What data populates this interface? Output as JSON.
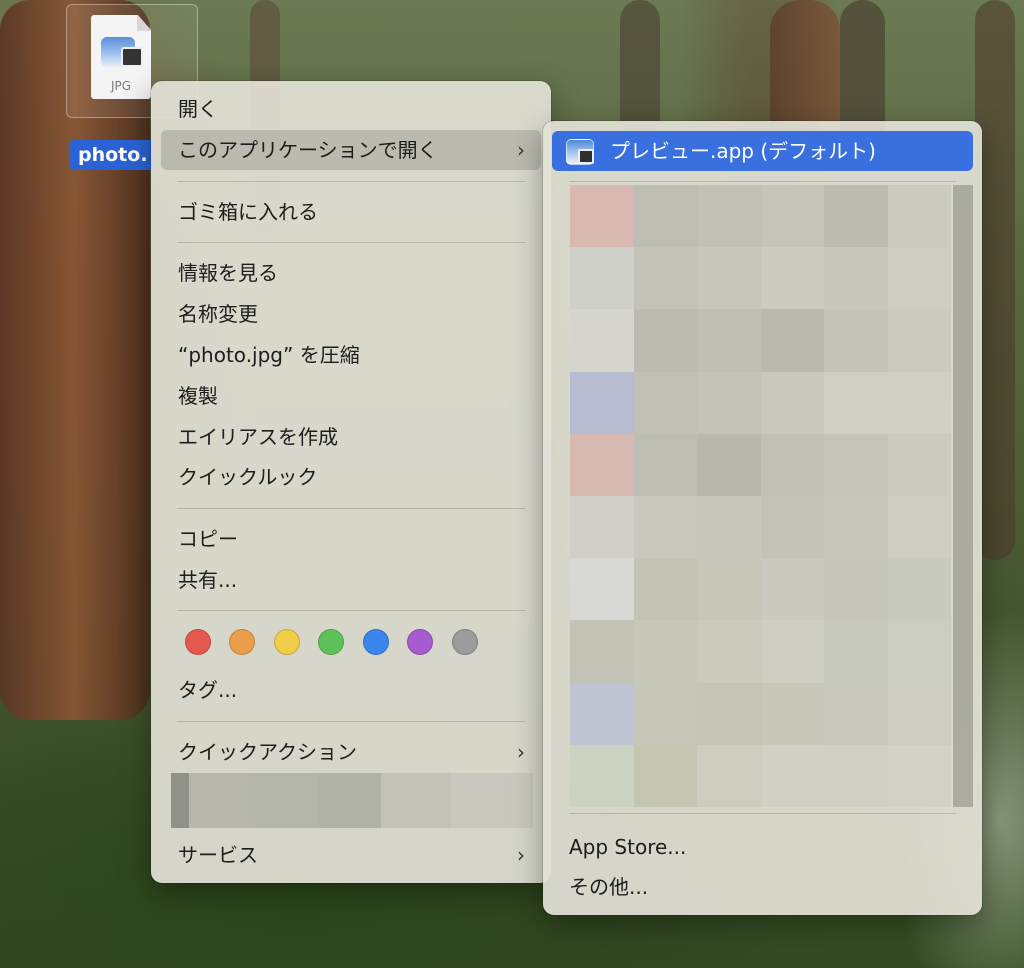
{
  "desktop": {
    "file": {
      "type_label": "JPG",
      "name": "photo."
    }
  },
  "context_menu": {
    "open": "開く",
    "open_with": "このアプリケーションで開く",
    "move_to_trash": "ゴミ箱に入れる",
    "get_info": "情報を見る",
    "rename": "名称変更",
    "compress": "“photo.jpg” を圧縮",
    "duplicate": "複製",
    "make_alias": "エイリアスを作成",
    "quick_look": "クイックルック",
    "copy": "コピー",
    "share": "共有...",
    "tags_label": "タグ...",
    "tag_colors": [
      "#e4584f",
      "#eb9d4b",
      "#f2cd4a",
      "#5ec25c",
      "#3c85ee",
      "#a65ccf",
      "#9c9c9c"
    ],
    "quick_actions": "クイックアクション",
    "services": "サービス",
    "chevron": "›"
  },
  "open_with_submenu": {
    "default_app": "プレビュー.app (デフォルト)",
    "app_store": "App Store...",
    "other": "その他..."
  }
}
